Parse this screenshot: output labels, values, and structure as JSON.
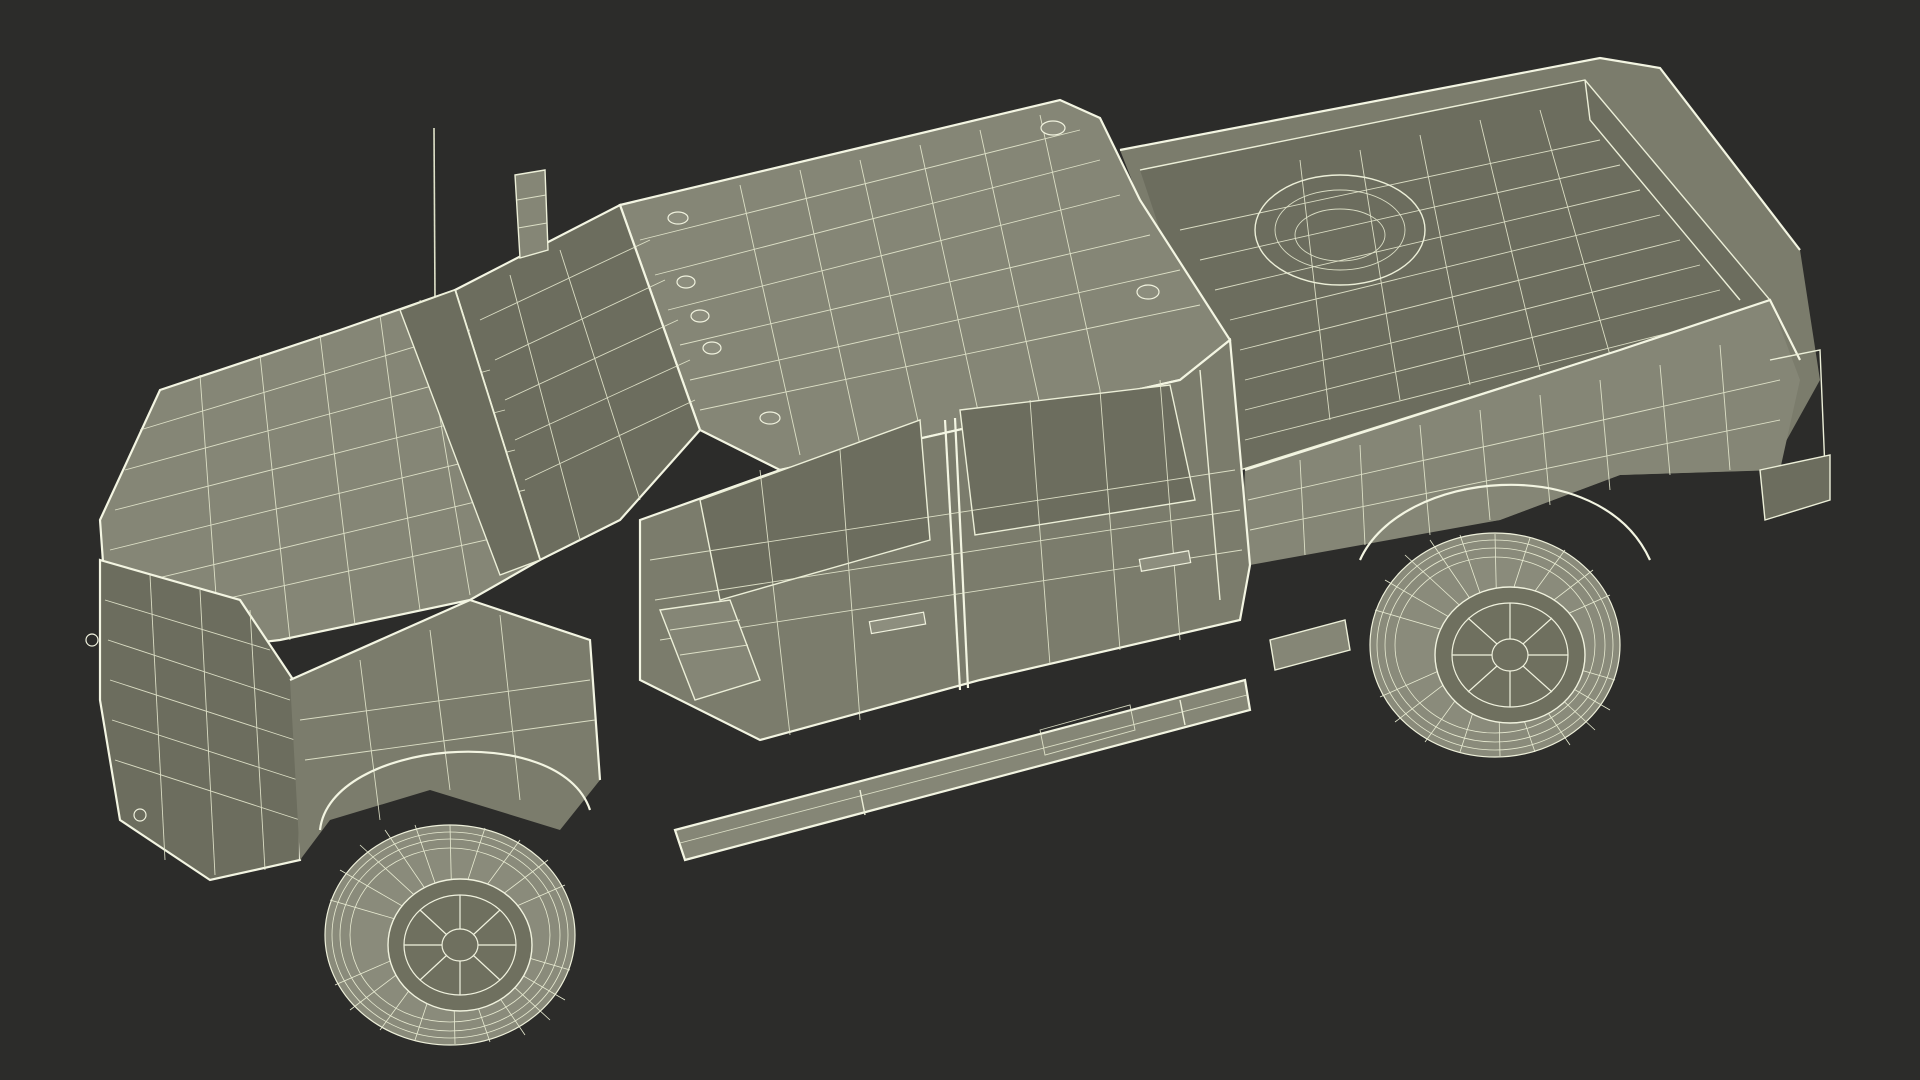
{
  "scene": {
    "subject": "pickup-truck-wireframe",
    "background_color": "#2c2c2a",
    "surface_color": "#7b7c6c",
    "wire_color": "#ecefd8"
  }
}
